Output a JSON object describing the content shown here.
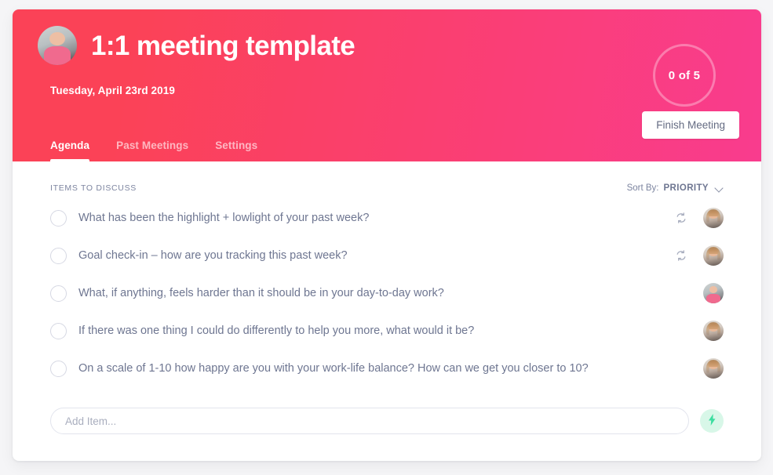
{
  "header": {
    "title": "1:1 meeting template",
    "date": "Tuesday, April 23rd 2019",
    "avatar_name": "user-avatar-hero",
    "progress": "0 of 5",
    "finish_label": "Finish Meeting",
    "gradient_start": "#fb4257",
    "gradient_end": "#f93c8e",
    "tabs": [
      {
        "label": "Agenda",
        "active": true
      },
      {
        "label": "Past Meetings",
        "active": false
      },
      {
        "label": "Settings",
        "active": false
      }
    ]
  },
  "list": {
    "heading": "ITEMS TO DISCUSS",
    "sort_prefix": "Sort By:",
    "sort_value": "PRIORITY",
    "items": [
      {
        "text": "What has been the highlight + lowlight of your past week?",
        "checked": false,
        "recurring": true,
        "avatar": "a"
      },
      {
        "text": "Goal check-in – how are you tracking this past week?",
        "checked": false,
        "recurring": true,
        "avatar": "a"
      },
      {
        "text": "What, if anything, feels harder than it should be in your day-to-day work?",
        "checked": false,
        "recurring": false,
        "avatar": "b"
      },
      {
        "text": "If there was one thing I could do differently to help you more, what would it be?",
        "checked": false,
        "recurring": false,
        "avatar": "a"
      },
      {
        "text": "On a scale of 1-10 how happy are you with your work-life balance? How can we get you closer to 10?",
        "checked": false,
        "recurring": false,
        "avatar": "a"
      }
    ]
  },
  "add_row": {
    "placeholder": "Add Item...",
    "bolt_icon": "lightning-bolt-icon",
    "bolt_bg": "#d8f7e8",
    "bolt_color": "#3ddda0"
  }
}
